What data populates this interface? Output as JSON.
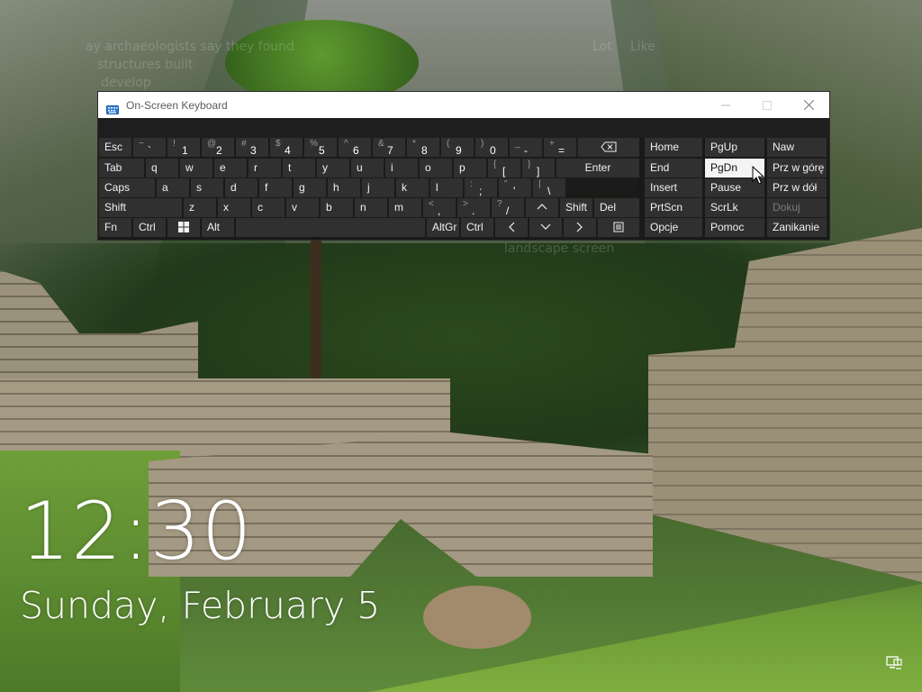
{
  "lock_screen": {
    "time": "12:30",
    "date": "Sunday, February 5",
    "faint_text": {
      "left": "ay archaeologists say they found",
      "left2": "structures built",
      "left3": "develop",
      "right1": "Lot",
      "right2": "Like",
      "mid": "landscape screen"
    }
  },
  "osk": {
    "title": "On-Screen Keyboard",
    "icon": "keyboard-icon",
    "controls": [
      "minimize",
      "maximize",
      "close"
    ],
    "rows": [
      [
        "Esc",
        "~ `",
        "! 1",
        "@ 2",
        "# 3",
        "$ 4",
        "% 5",
        "^ 6",
        "& 7",
        "* 8",
        "( 9",
        ") 0",
        "_ -",
        "+ =",
        "backspace"
      ],
      [
        "Tab",
        "q",
        "w",
        "e",
        "r",
        "t",
        "y",
        "u",
        "i",
        "o",
        "p",
        "{ [",
        "} ]",
        "Enter"
      ],
      [
        "Caps",
        "a",
        "s",
        "d",
        "f",
        "g",
        "h",
        "j",
        "k",
        "l",
        ": ;",
        "\" '",
        "| \\"
      ],
      [
        "Shift",
        "z",
        "x",
        "c",
        "v",
        "b",
        "n",
        "m",
        "< ,",
        "> .",
        "? /",
        "up",
        "Shift",
        "Del"
      ],
      [
        "Fn",
        "Ctrl",
        "windows",
        "Alt",
        "space",
        "AltGr",
        "Ctrl",
        "left",
        "down",
        "right",
        "menu"
      ]
    ],
    "nav_keys": [
      [
        "Home",
        "PgUp",
        "Naw"
      ],
      [
        "End",
        "PgDn",
        "Prz w górę"
      ],
      [
        "Insert",
        "Pause",
        "Prz w dół"
      ],
      [
        "PrtScn",
        "ScrLk",
        "Dokuj"
      ],
      [
        "Opcje",
        "Pomoc",
        "Zanikanie"
      ]
    ],
    "highlighted_key": "PgDn",
    "disabled_key": "Dokuj"
  },
  "colors": {
    "key_bg": "#303030",
    "key_highlight": "#f4f4f4",
    "osk_bg": "#161616",
    "text": "#f2f2f2"
  }
}
